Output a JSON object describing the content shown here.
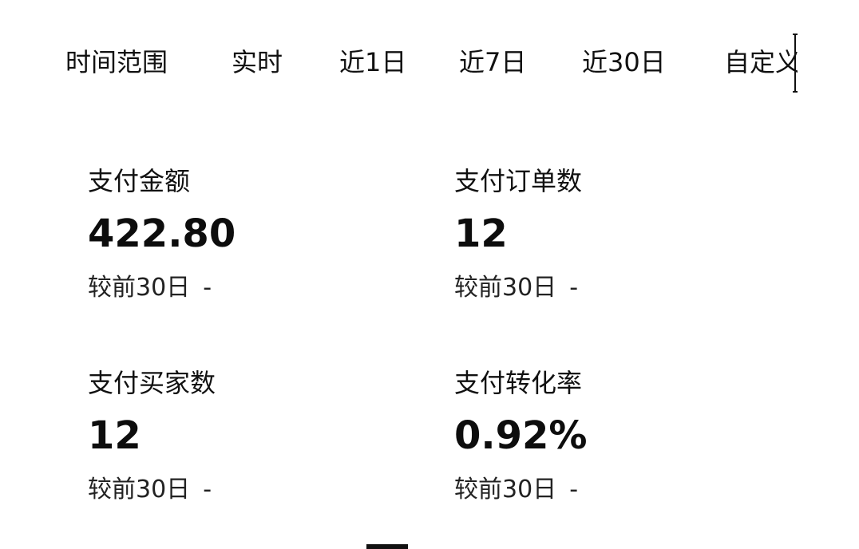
{
  "time_range": {
    "label": "时间范围",
    "tabs": [
      {
        "label": "实时"
      },
      {
        "label": "近1日"
      },
      {
        "label": "近7日"
      },
      {
        "label": "近30日"
      },
      {
        "label": "自定义"
      }
    ]
  },
  "metrics": [
    {
      "label": "支付金额",
      "value": "422.80",
      "compare_label": "较前30日",
      "compare_value": "-"
    },
    {
      "label": "支付订单数",
      "value": "12",
      "compare_label": "较前30日",
      "compare_value": "-"
    },
    {
      "label": "支付买家数",
      "value": "12",
      "compare_label": "较前30日",
      "compare_value": "-"
    },
    {
      "label": "支付转化率",
      "value": "0.92%",
      "compare_label": "较前30日",
      "compare_value": "-"
    }
  ]
}
